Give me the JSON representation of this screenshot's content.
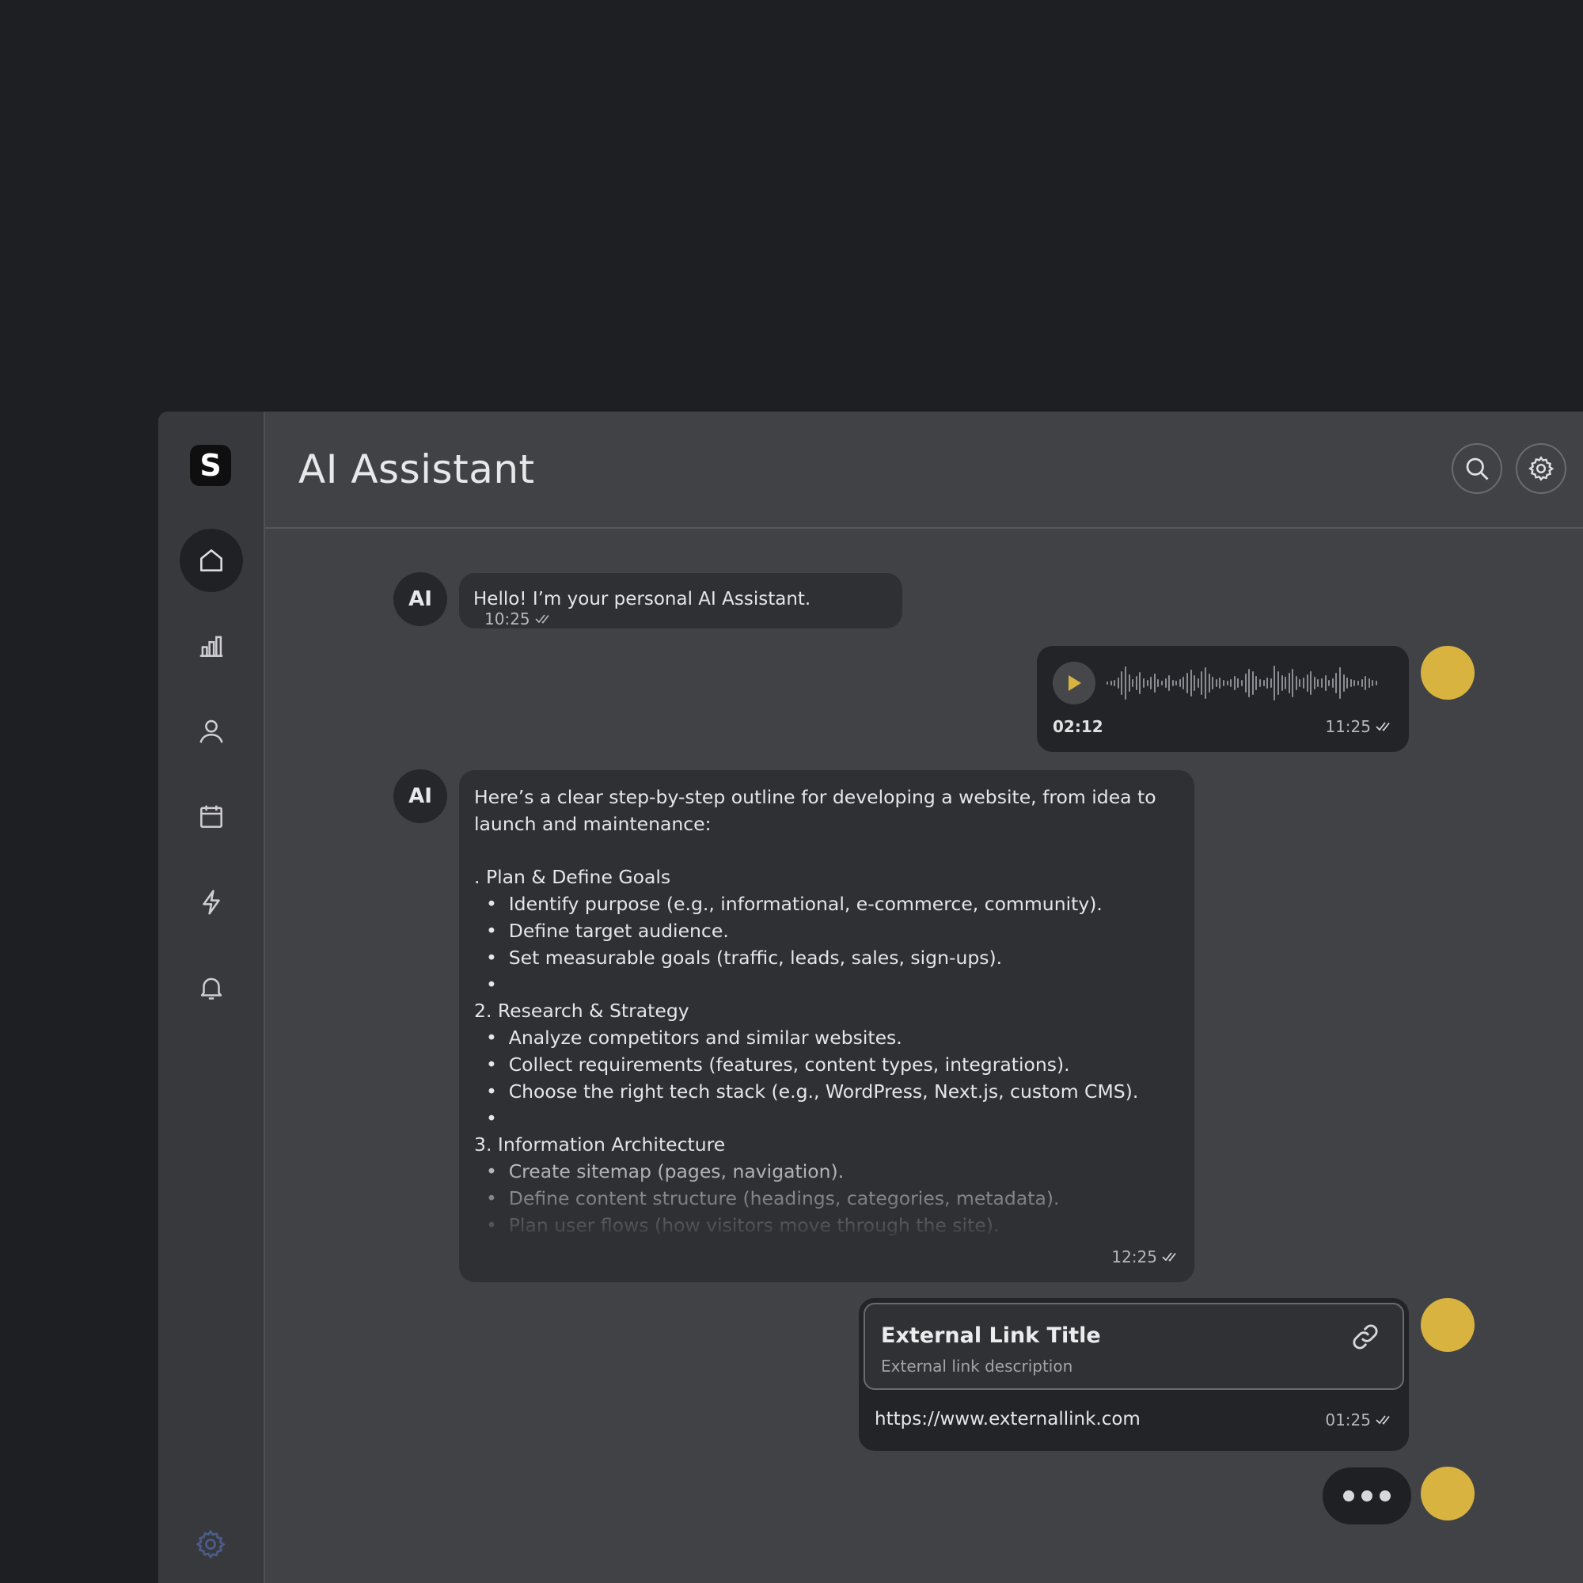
{
  "app": {
    "logo_letter": "S",
    "title": "AI Assistant"
  },
  "sidebar": {
    "items": [
      {
        "name": "home",
        "icon": "home-icon",
        "active": true
      },
      {
        "name": "analytics",
        "icon": "bar-chart-icon",
        "active": false
      },
      {
        "name": "profile",
        "icon": "user-icon",
        "active": false
      },
      {
        "name": "calendar",
        "icon": "calendar-icon",
        "active": false
      },
      {
        "name": "automation",
        "icon": "lightning-icon",
        "active": false
      },
      {
        "name": "notifications",
        "icon": "bell-icon",
        "active": false
      }
    ],
    "bottom_icon": "gear-icon"
  },
  "header": {
    "search_icon": "search-icon",
    "settings_icon": "gear-icon"
  },
  "messages": {
    "m1": {
      "avatar": "AI",
      "text": "Hello! I’m your personal AI Assistant.",
      "time": "10:25"
    },
    "voice": {
      "duration": "02:12",
      "time": "11:25"
    },
    "m3": {
      "avatar": "AI",
      "time": "12:25",
      "lines": [
        "Here’s a clear step-by-step outline for developing a website, from idea to",
        "launch and maintenance:",
        "",
        ". Plan & Define Goals",
        "  •  Identify purpose (e.g., informational, e-commerce, community).",
        "  •  Define target audience.",
        "  •  Set measurable goals (traffic, leads, sales, sign-ups).",
        "  •",
        "2. Research & Strategy",
        "  •  Analyze competitors and similar websites.",
        "  •  Collect requirements (features, content types, integrations).",
        "  •  Choose the right tech stack (e.g., WordPress, Next.js, custom CMS).",
        "  •",
        "3. Information Architecture",
        "  •  Create sitemap (pages, navigation).",
        "  •  Define content structure (headings, categories, metadata).",
        "  •  Plan user flows (how visitors move through the site)."
      ]
    },
    "link": {
      "title": "External Link Title",
      "description": "External link description",
      "url": "https://www.externallink.com",
      "time": "01:25"
    }
  },
  "colors": {
    "background": "#1e1f23",
    "panel": "#414246",
    "sidebar": "#38393d",
    "bubble": "#2f3034",
    "accent": "#d8b33f"
  }
}
